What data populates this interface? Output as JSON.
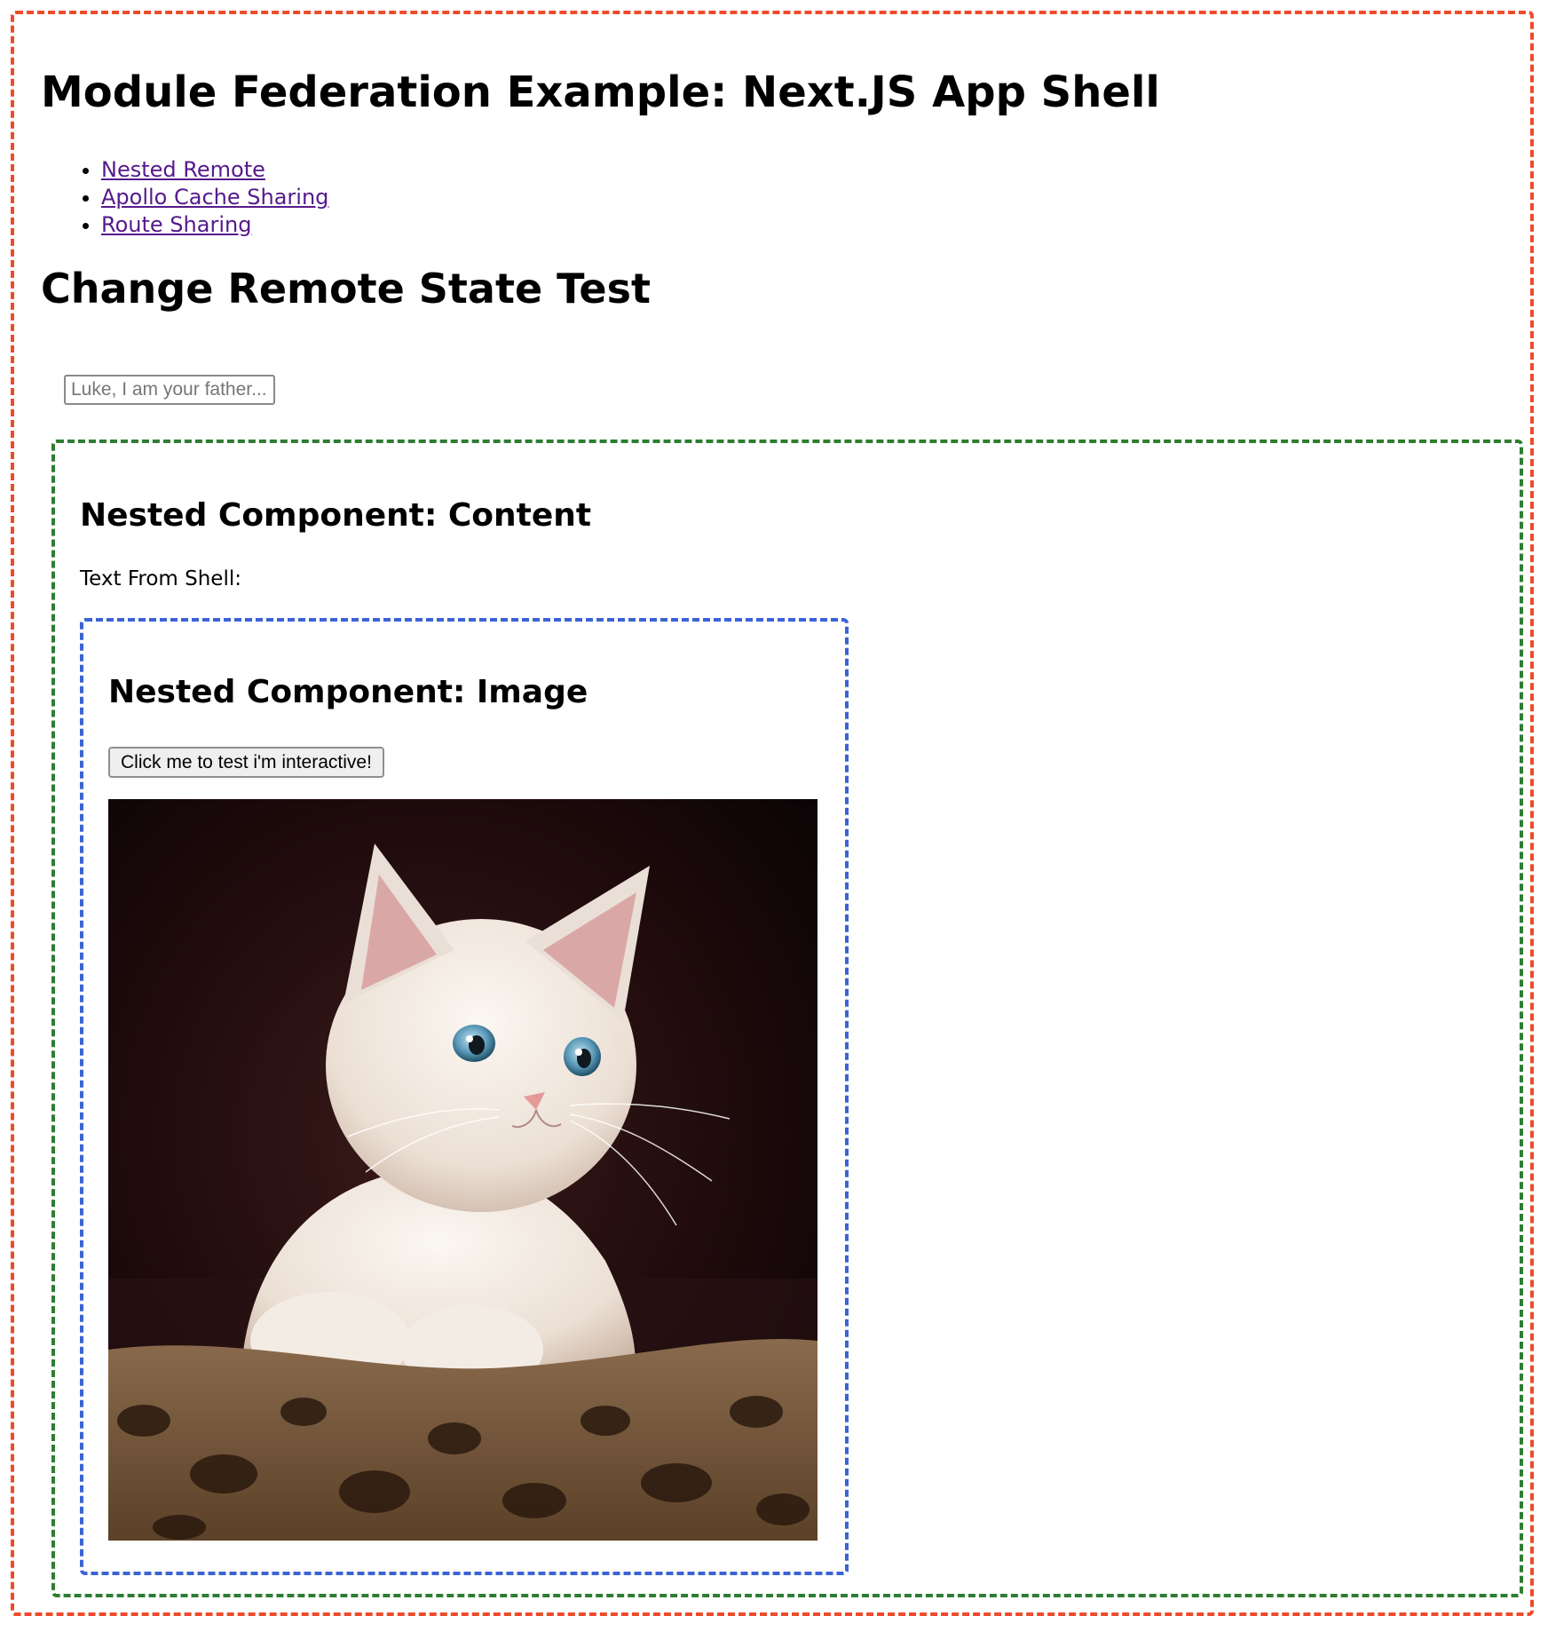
{
  "shell": {
    "title": "Module Federation Example: Next.JS App Shell",
    "nav_links": [
      {
        "label": "Nested Remote"
      },
      {
        "label": "Apollo Cache Sharing"
      },
      {
        "label": "Route Sharing"
      }
    ],
    "section_title": "Change Remote State Test",
    "state_input": {
      "value": "",
      "placeholder": "Luke, I am your father..."
    },
    "border_color": "#ee4b2b"
  },
  "content_component": {
    "title": "Nested Component: Content",
    "shell_text_label": "Text From Shell:",
    "border_color": "#2e7d32"
  },
  "image_component": {
    "title": "Nested Component: Image",
    "button_label": "Click me to test i'm interactive!",
    "image_subject": "white kitten on leopard-print cushion",
    "border_color": "#3b63d6"
  },
  "link_color": "#551a8b"
}
